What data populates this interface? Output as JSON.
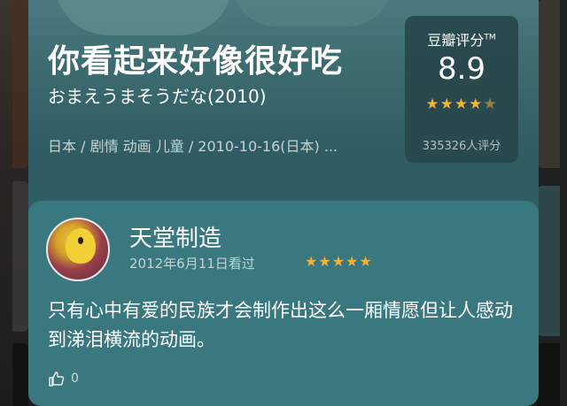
{
  "movie": {
    "title": "你看起来好像很好吃",
    "original_title": "おまえうまそうだな(2010)",
    "meta": "日本 / 剧情 动画 儿童 / 2010-10-16(日本) ..."
  },
  "rating": {
    "source": "豆瓣评分",
    "trademark": "TM",
    "score": "8.9",
    "stars": "★★★★★",
    "stars_value": 4.5,
    "count": "335326人评分"
  },
  "review": {
    "user_name": "天堂制造",
    "date": "2012年6月11日看过",
    "stars": "★★★★★",
    "stars_value": 5,
    "text": "只有心中有爱的民族才会制作出这么一厢情愿但让人感动到涕泪横流的动画。",
    "likes": "0"
  },
  "icons": {
    "like": "thumbs-up-icon",
    "avatar": "user-avatar"
  },
  "colors": {
    "card_bg": "#2f5d63",
    "review_bg": "#3a787f",
    "star": "#f3b03a"
  }
}
